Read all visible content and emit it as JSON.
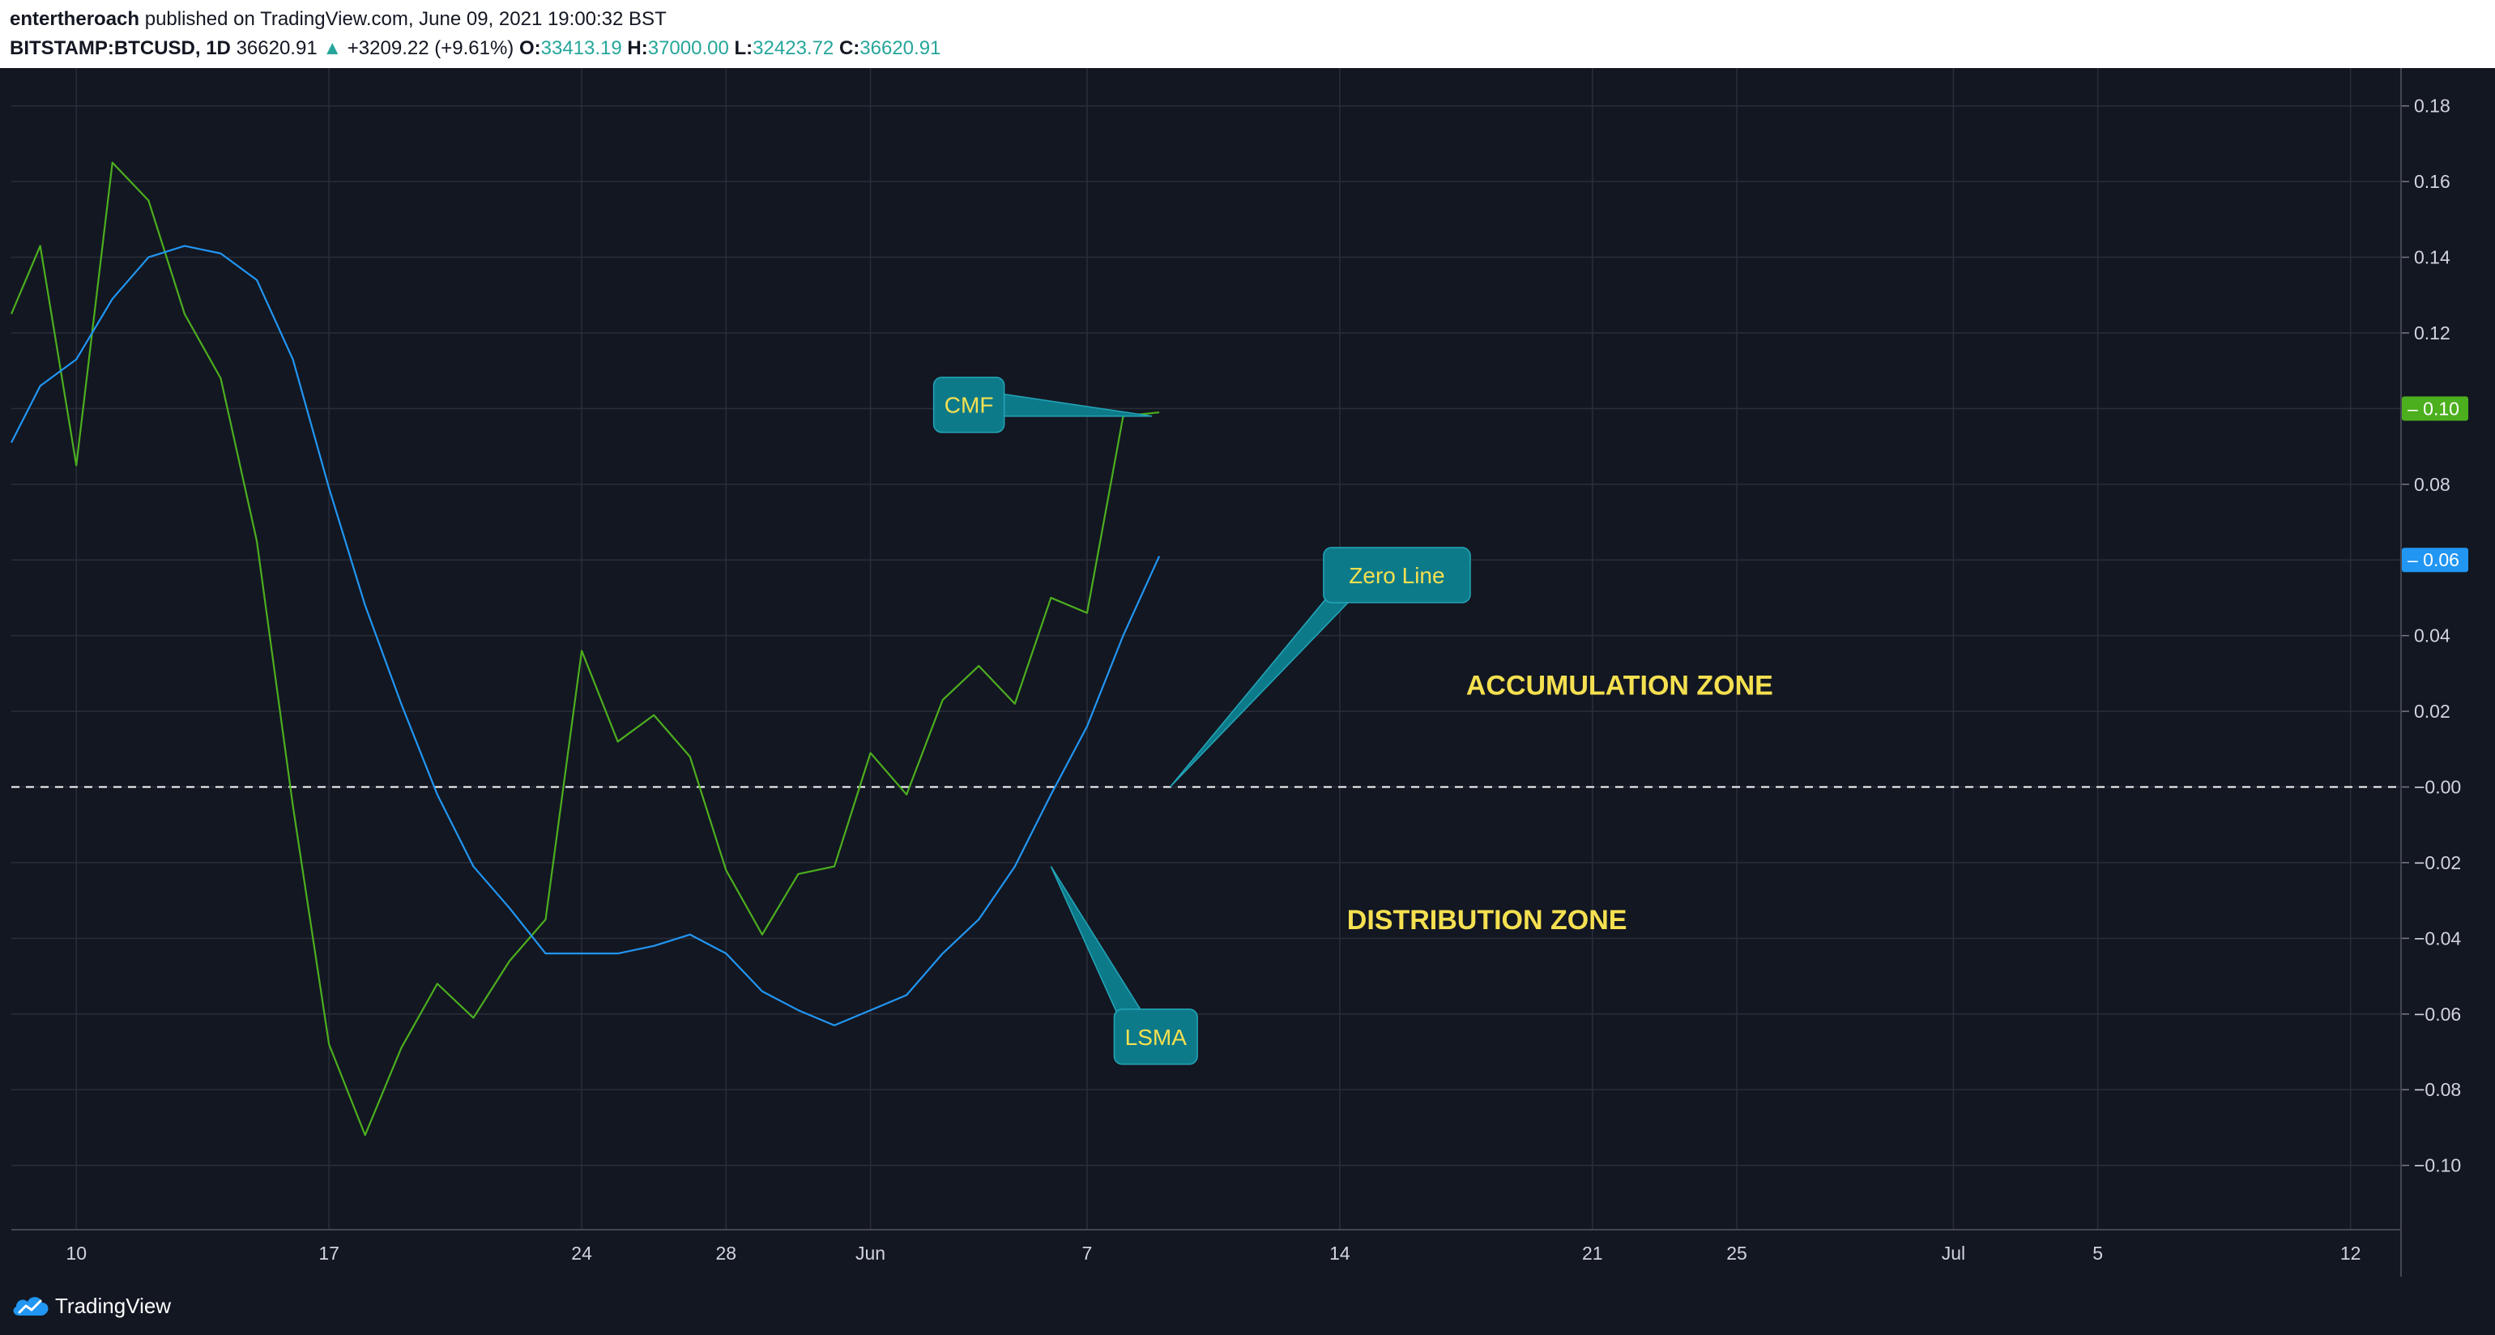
{
  "header": {
    "author": "entertheroach",
    "published_text": "published on TradingView.com, June 09, 2021 19:00:32 BST",
    "symbol": "BITSTAMP:BTCUSD, 1D",
    "price": "36620.91",
    "change": "+3209.22 (+9.61%)",
    "open_label": "O:",
    "open_value": "33413.19",
    "high_label": "H:",
    "high_value": "37000.00",
    "low_label": "L:",
    "low_value": "32423.72",
    "close_label": "C:",
    "close_value": "36620.91"
  },
  "footer": {
    "brand": "TradingView"
  },
  "colors": {
    "background": "#131722",
    "grid": "#2a2e39",
    "cmf": "#4caf1e",
    "lsma": "#2196f3",
    "callout": "#0d7a8a",
    "callout_text": "#f5e050",
    "zone_text": "#f5e050",
    "axis_text": "#d1d4dc"
  },
  "chart_data": {
    "type": "line",
    "x_ticks": [
      {
        "label": "10",
        "day": 1
      },
      {
        "label": "17",
        "day": 8
      },
      {
        "label": "24",
        "day": 15
      },
      {
        "label": "28",
        "day": 19
      },
      {
        "label": "Jun",
        "day": 23
      },
      {
        "label": "7",
        "day": 29
      },
      {
        "label": "14",
        "day": 36
      },
      {
        "label": "21",
        "day": 43
      },
      {
        "label": "25",
        "day": 47
      },
      {
        "label": "Jul",
        "day": 53
      },
      {
        "label": "5",
        "day": 57
      },
      {
        "label": "12",
        "day": 64
      }
    ],
    "xlim": [
      -0.8,
      65.4
    ],
    "ylim": [
      -0.117,
      0.19
    ],
    "y_ticks": [
      0.18,
      0.16,
      0.14,
      0.12,
      0.1,
      0.08,
      0.06,
      0.04,
      0.02,
      0.0,
      -0.02,
      -0.04,
      -0.06,
      -0.08,
      -0.1
    ],
    "y_tick_labels": [
      "0.18",
      "0.16",
      "0.14",
      "0.12",
      "0.10",
      "0.08",
      "0.06",
      "0.04",
      "0.02",
      "−0.00",
      "−0.02",
      "−0.04",
      "−0.06",
      "−0.08",
      "−0.10"
    ],
    "grid": true,
    "series": [
      {
        "color": "#4caf1e",
        "x": [
          -0.8,
          0,
          1,
          2,
          3,
          4,
          5,
          6,
          7,
          8,
          9,
          10,
          11,
          12,
          13,
          14,
          15,
          16,
          17,
          18,
          19,
          20,
          21,
          22,
          23,
          24,
          25,
          26,
          27,
          28,
          29,
          30,
          31
        ],
        "y": [
          0.125,
          0.143,
          0.085,
          0.165,
          0.155,
          0.125,
          0.108,
          0.065,
          -0.005,
          -0.068,
          -0.092,
          -0.069,
          -0.052,
          -0.061,
          -0.046,
          -0.035,
          0.036,
          0.012,
          0.019,
          0.008,
          -0.022,
          -0.039,
          -0.023,
          -0.021,
          0.009,
          -0.002,
          0.023,
          0.032,
          0.022,
          0.05,
          0.046,
          0.098,
          0.099
        ]
      },
      {
        "color": "#2196f3",
        "x": [
          -0.8,
          0,
          1,
          2,
          3,
          4,
          5,
          6,
          7,
          8,
          9,
          10,
          11,
          12,
          13,
          14,
          15,
          16,
          17,
          18,
          19,
          20,
          21,
          22,
          23,
          24,
          25,
          26,
          27,
          28,
          29,
          30,
          31
        ],
        "y": [
          0.091,
          0.106,
          0.113,
          0.129,
          0.14,
          0.143,
          0.141,
          0.134,
          0.113,
          0.079,
          0.048,
          0.022,
          -0.002,
          -0.021,
          -0.032,
          -0.044,
          -0.044,
          -0.044,
          -0.042,
          -0.039,
          -0.044,
          -0.054,
          -0.059,
          -0.063,
          -0.059,
          -0.055,
          -0.044,
          -0.035,
          -0.021,
          -0.002,
          0.016,
          0.04,
          0.061
        ]
      }
    ],
    "zero_line": {
      "y": 0,
      "style": "dashed",
      "color": "#ffffff"
    },
    "last_value_labels": [
      {
        "text": "0.10",
        "y": 0.1,
        "color": "#4caf1e"
      },
      {
        "text": "0.06",
        "y": 0.06,
        "color": "#2196f3"
      }
    ],
    "annotations": [
      {
        "text": "CMF",
        "box_x": 25.2,
        "box_y": 0.101,
        "point_x": 30.8,
        "point_y": 0.098
      },
      {
        "text": "Zero Line",
        "box_x": 36.0,
        "box_y": 0.056,
        "point_x": 31.3,
        "point_y": 0.0
      },
      {
        "text": "LSMA",
        "box_x": 30.2,
        "box_y": -0.066,
        "point_x": 28.0,
        "point_y": -0.021
      }
    ],
    "zone_labels": [
      {
        "text": "ACCUMULATION ZONE",
        "x": 39.5,
        "y": 0.027
      },
      {
        "text": "DISTRIBUTION ZONE",
        "x": 36.2,
        "y": -0.035
      }
    ]
  }
}
